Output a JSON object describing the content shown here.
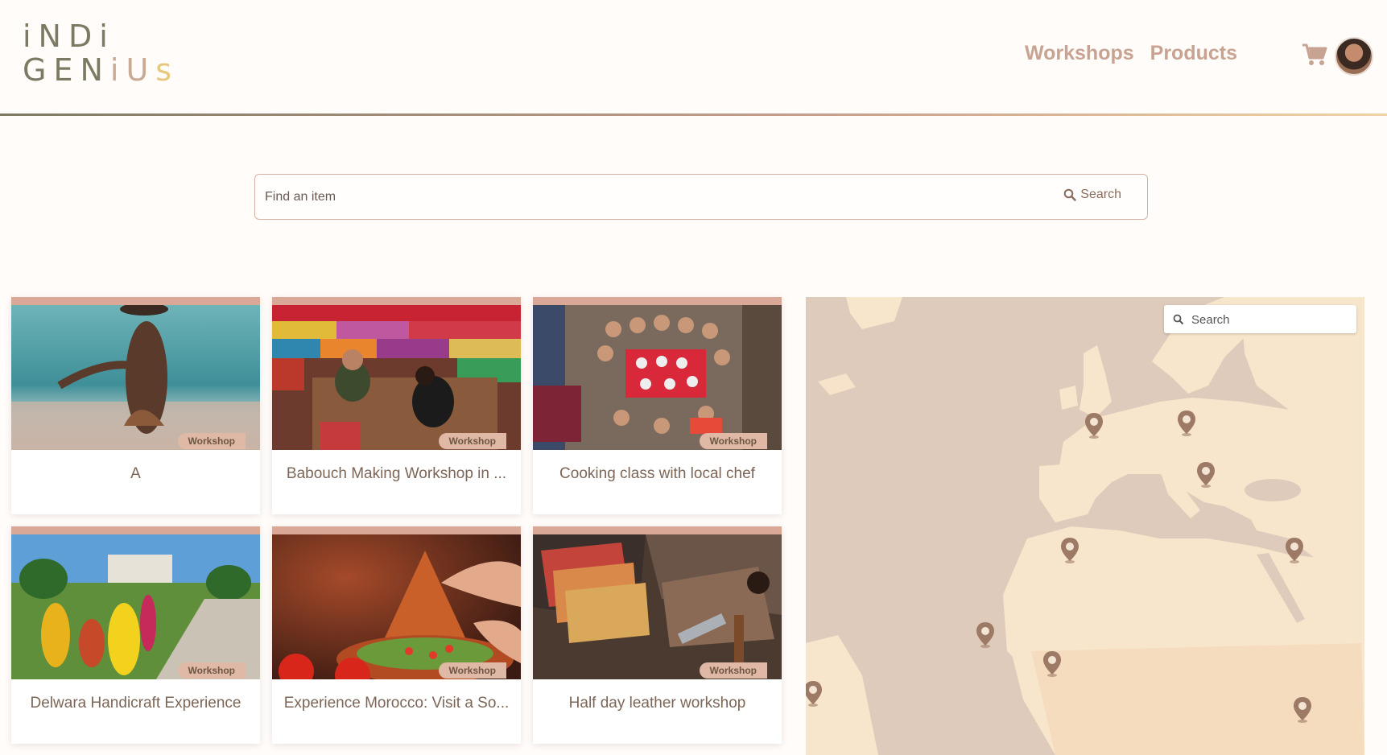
{
  "brand": {
    "line1": "iNDi",
    "line2_a": "GEN",
    "line2_b": "iU",
    "line2_c": "s"
  },
  "nav": {
    "workshops": "Workshops",
    "products": "Products"
  },
  "search": {
    "placeholder": "Find an item",
    "button": "Search"
  },
  "map": {
    "search_placeholder": "Search"
  },
  "cards": [
    {
      "title": "A",
      "badge": "Workshop"
    },
    {
      "title": "Babouch Making Workshop in ...",
      "badge": "Workshop"
    },
    {
      "title": "Cooking class with local chef",
      "badge": "Workshop"
    },
    {
      "title": "Delwara Handicraft Experience",
      "badge": "Workshop"
    },
    {
      "title": "Experience Morocco: Visit a So...",
      "badge": "Workshop"
    },
    {
      "title": "Half day leather workshop",
      "badge": "Workshop"
    }
  ],
  "colors": {
    "accent": "#d9a896",
    "brand_olive": "#7d7a64",
    "brand_gold": "#e8c77f",
    "map_water": "#dfcbbb",
    "map_land": "#f8e6cc"
  }
}
